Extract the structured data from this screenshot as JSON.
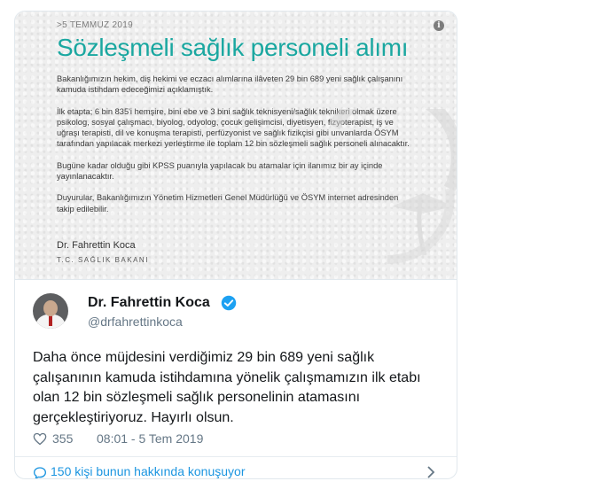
{
  "media": {
    "date": ">5 TEMMUZ 2019",
    "headline": "Sözleşmeli sağlık personeli alımı",
    "paragraphs": [
      "Bakanlığımızın hekim, diş hekimi ve eczacı alımlarına ilâveten 29 bin 689 yeni sağlık çalışanını kamuda istihdam edeceğimizi açıklamıştık.",
      "İlk etapta; 6 bin 835'i hemşire, bini ebe ve 3 bini sağlık teknisyeni/sağlık teknikeri olmak üzere psikolog, sosyal çalışmacı, biyolog, odyolog, çocuk gelişimcisi, diyetisyen, fizyoterapist, iş ve uğraşı terapisti, dil ve konuşma terapisti, perfüzyonist ve sağlık fizikçisi gibi unvanlarda ÖSYM tarafından yapılacak merkezi yerleştirme ile toplam 12 bin sözleşmeli sağlık personeli alınacaktır.",
      "Bugüne kadar olduğu gibi KPSS puanıyla yapılacak bu atamalar için ilanımız bir ay içinde yayınlanacaktır.",
      "Duyurular, Bakanlığımızın Yönetim Hizmetleri Genel Müdürlüğü ve ÖSYM internet adresinden takip edilebilir."
    ],
    "signature_name": "Dr. Fahrettin Koca",
    "signature_title": "T.C. SAĞLIK BAKANI",
    "info_glyph": "i"
  },
  "user": {
    "display_name": "Dr. Fahrettin Koca",
    "handle": "@drfahrettinkoca",
    "verified": true
  },
  "tweet": {
    "text": "Daha önce müjdesini verdiğimiz 29 bin 689 yeni sağlık çalışanının kamuda istihdamına yönelik çalışmamızın ilk etabı olan 12 bin sözleşmeli sağlık personelinin atamasını gerçekleştiriyoruz. Hayırlı olsun.",
    "likes": "355",
    "timestamp": "08:01 - 5 Tem 2019"
  },
  "footer": {
    "discussion_label": "150 kişi bunun hakkında konuşuyor"
  },
  "colors": {
    "headline_teal": "#1aa7a0",
    "verified_blue": "#1da1f2",
    "link_blue": "#1b95e0",
    "muted_gray": "#657786"
  },
  "icons": [
    "info-icon",
    "verified-badge-icon",
    "heart-icon",
    "speech-bubble-icon",
    "chevron-right-icon"
  ]
}
